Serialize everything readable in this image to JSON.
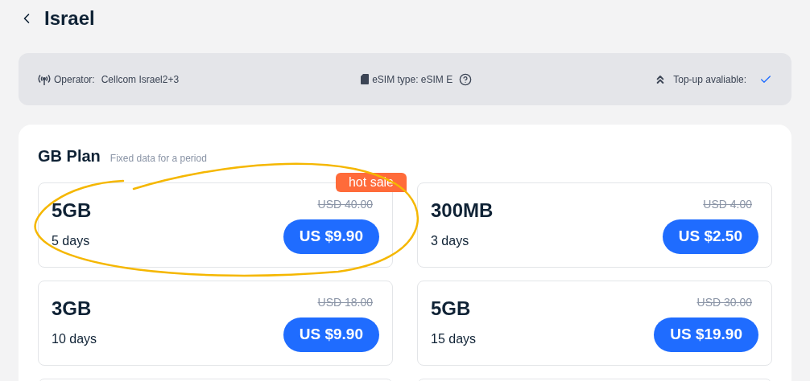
{
  "header": {
    "title": "Israel"
  },
  "info_bar": {
    "operator_label": "Operator:",
    "operator_value": "Cellcom Israel2+3",
    "esim_type": "eSIM type: eSIM E",
    "topup_label": "Top-up avaliable:",
    "topup_available": true
  },
  "section": {
    "title": "GB Plan",
    "subtitle": "Fixed data for a period"
  },
  "plans": [
    {
      "data": "5GB",
      "days": "5 days",
      "old_price": "USD 40.00",
      "price": "US $9.90",
      "badge": "hot sale"
    },
    {
      "data": "300MB",
      "days": "3 days",
      "old_price": "USD 4.00",
      "price": "US $2.50"
    },
    {
      "data": "3GB",
      "days": "10 days",
      "old_price": "USD 18.00",
      "price": "US $9.90"
    },
    {
      "data": "5GB",
      "days": "15 days",
      "old_price": "USD 30.00",
      "price": "US $19.90"
    }
  ]
}
